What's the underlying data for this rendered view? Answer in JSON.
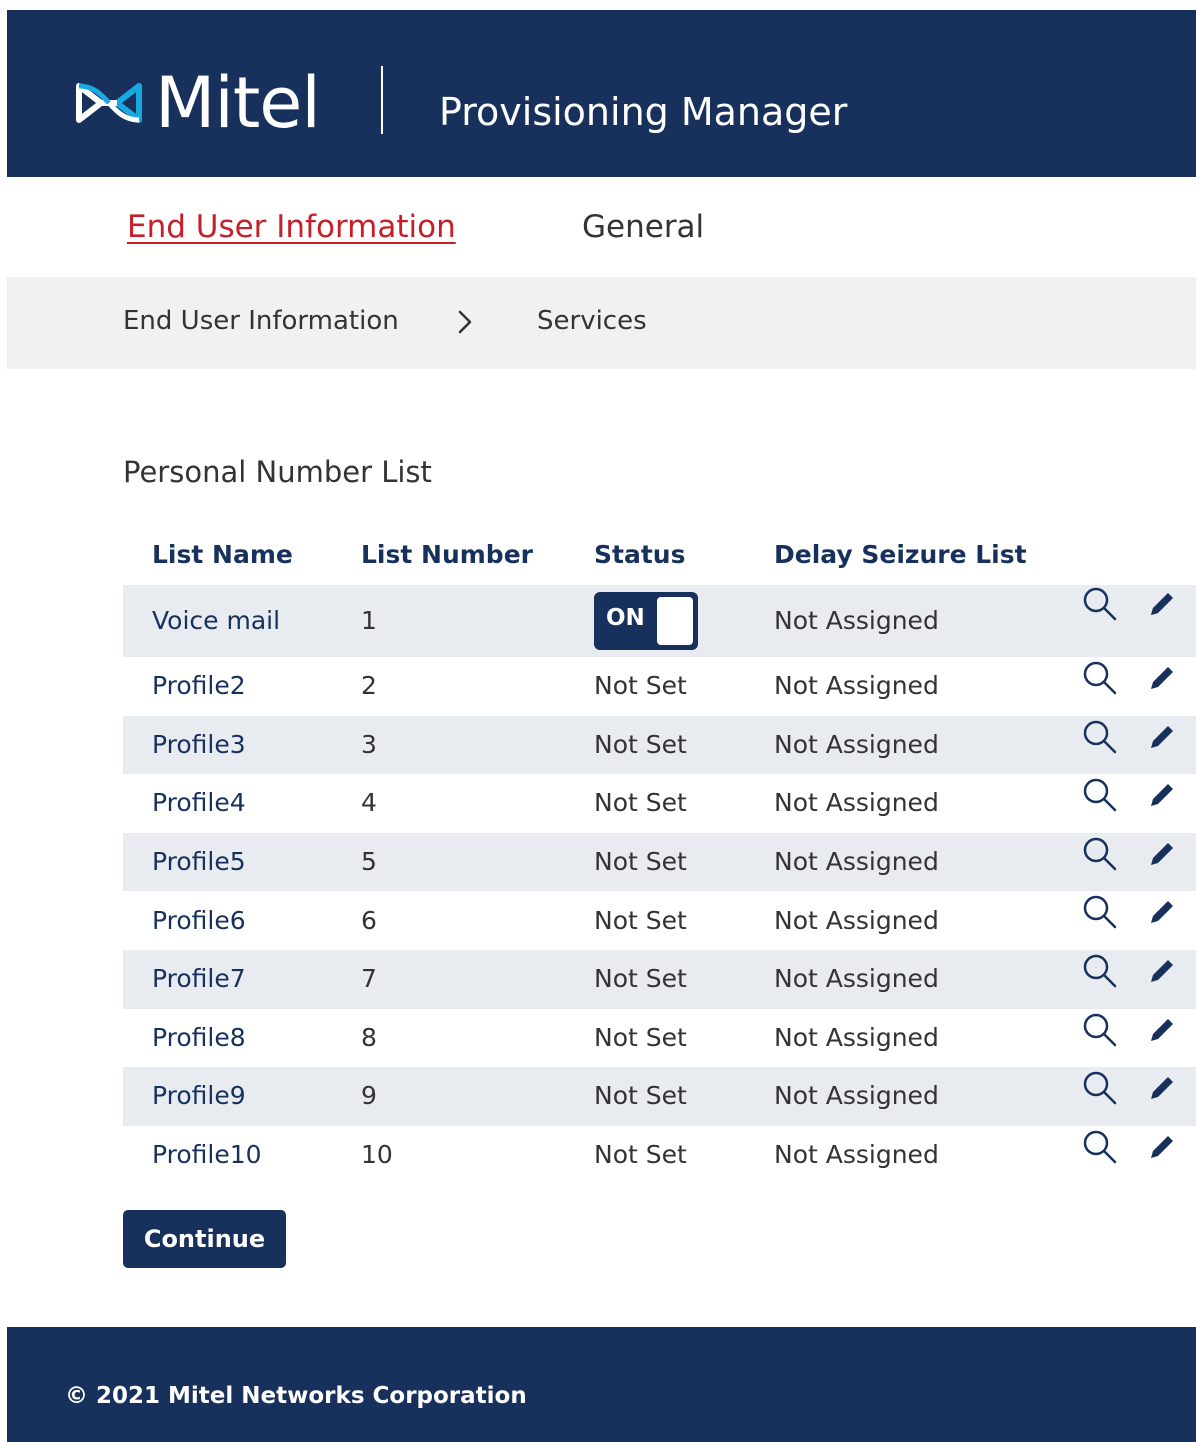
{
  "header": {
    "logo_text": "Mitel",
    "app_title": "Provisioning Manager"
  },
  "tabs": [
    {
      "label": "End User Information",
      "active": true
    },
    {
      "label": "General",
      "active": false
    }
  ],
  "breadcrumb": {
    "items": [
      "End User Information",
      "Services"
    ],
    "separator_icon": "chevron-right-icon"
  },
  "section": {
    "title": "Personal Number List"
  },
  "table": {
    "columns": [
      "List Name",
      "List Number",
      "Status",
      "Delay Seizure List"
    ],
    "rows": [
      {
        "name": "Voice mail",
        "number": "1",
        "status": "ON",
        "status_toggle": true,
        "delay": "Not Assigned"
      },
      {
        "name": "Profile2",
        "number": "2",
        "status": "Not Set",
        "delay": "Not Assigned"
      },
      {
        "name": "Profile3",
        "number": "3",
        "status": "Not Set",
        "delay": "Not Assigned"
      },
      {
        "name": "Profile4",
        "number": "4",
        "status": "Not Set",
        "delay": "Not Assigned"
      },
      {
        "name": "Profile5",
        "number": "5",
        "status": "Not Set",
        "delay": "Not Assigned"
      },
      {
        "name": "Profile6",
        "number": "6",
        "status": "Not Set",
        "delay": "Not Assigned"
      },
      {
        "name": "Profile7",
        "number": "7",
        "status": "Not Set",
        "delay": "Not Assigned"
      },
      {
        "name": "Profile8",
        "number": "8",
        "status": "Not Set",
        "delay": "Not Assigned"
      },
      {
        "name": "Profile9",
        "number": "9",
        "status": "Not Set",
        "delay": "Not Assigned"
      },
      {
        "name": "Profile10",
        "number": "10",
        "status": "Not Set",
        "delay": "Not Assigned"
      }
    ],
    "row_actions": [
      "search-icon",
      "edit-pencil-icon"
    ]
  },
  "actions": {
    "continue_label": "Continue"
  },
  "footer": {
    "copyright": "© 2021 Mitel Networks Corporation"
  },
  "colors": {
    "brand_navy": "#17315c",
    "active_tab_red": "#c51f2a",
    "row_shade": "#e8ebf0",
    "breadcrumb_bg": "#f1f1f1",
    "logo_accent": "#19a8e0"
  }
}
